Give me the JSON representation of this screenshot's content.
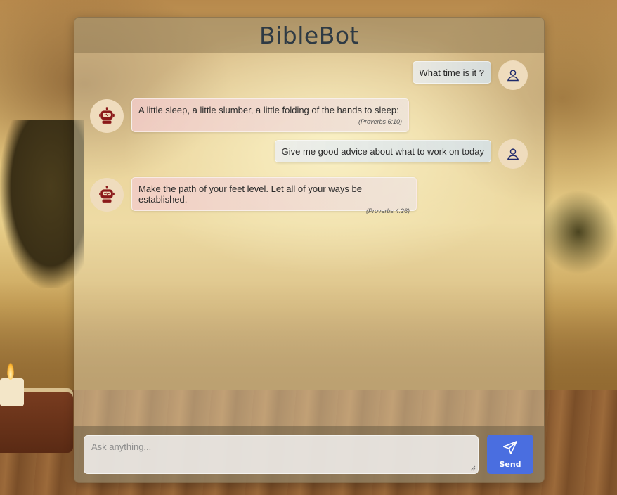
{
  "app": {
    "title": "BibleBot"
  },
  "messages": [
    {
      "role": "user",
      "text": "What time is it ?"
    },
    {
      "role": "bot",
      "text": "A little sleep, a little slumber, a little folding of the hands to sleep:",
      "reference": "(Proverbs 6:10)"
    },
    {
      "role": "user",
      "text": "Give me good advice about what to work on today"
    },
    {
      "role": "bot",
      "text": "Make the path of your feet level. Let all of your ways be established.",
      "reference": "(Proverbs 4:26)"
    }
  ],
  "composer": {
    "placeholder": "Ask anything...",
    "value": "",
    "send_label": "Send"
  },
  "icons": {
    "user_avatar": "user-icon",
    "bot_avatar": "robot-icon",
    "send": "paper-plane-icon"
  },
  "colors": {
    "accent": "#4a6ee0",
    "bot_icon": "#8b1a1a",
    "user_icon": "#1f2a6b",
    "title": "#2e3a44"
  }
}
